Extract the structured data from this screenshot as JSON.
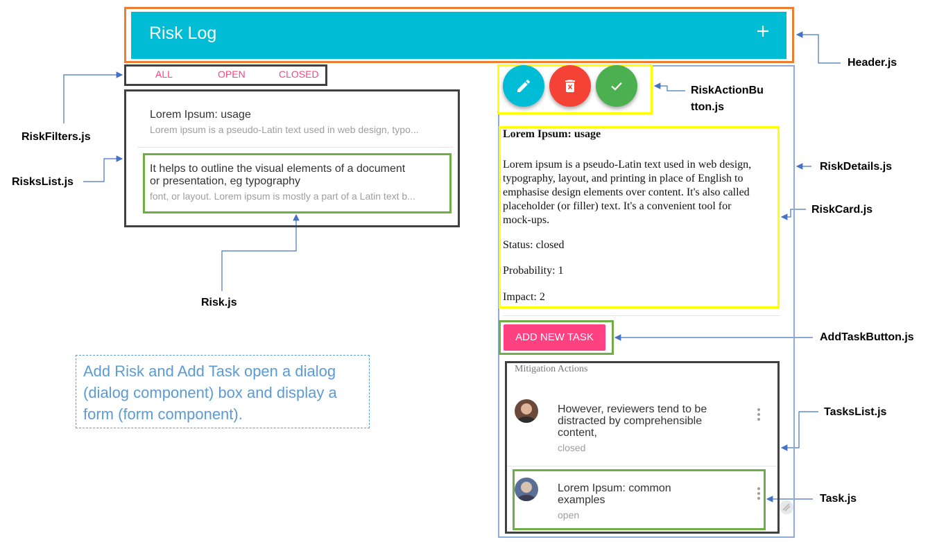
{
  "header": {
    "title": "Risk Log",
    "add_icon": "plus-icon",
    "component_label": "Header.js"
  },
  "filters": {
    "tabs": [
      "ALL",
      "OPEN",
      "CLOSED"
    ],
    "component_label": "RiskFilters.js"
  },
  "risks_list": {
    "component_label": "RisksList.js",
    "items": [
      {
        "title": "Lorem Ipsum: usage",
        "subtitle": "Lorem ipsum is a pseudo-Latin text used in web design, typo..."
      },
      {
        "title_line1": "It helps to outline the visual elements of a document",
        "title_line2": "or presentation, eg typography",
        "subtitle": "font, or layout. Lorem ipsum is mostly a part of a Latin text b..."
      }
    ]
  },
  "risk_label": "Risk.js",
  "risk_action_buttons": {
    "component_label_line1": "RiskActionBu",
    "component_label_line2": "tton.js",
    "buttons": [
      {
        "icon": "pencil-icon",
        "color": "#00BCD4"
      },
      {
        "icon": "trash-icon",
        "color": "#F44336"
      },
      {
        "icon": "check-icon",
        "color": "#4CAF50"
      }
    ]
  },
  "risk_details_label": "RiskDetails.js",
  "risk_card": {
    "component_label": "RiskCard.js",
    "title": "Lorem Ipsum: usage",
    "description_lines": [
      "Lorem ipsum is a pseudo-Latin text used in web design,",
      "typography, layout, and printing in place of English to",
      "emphasise design elements over content. It's also called",
      "placeholder (or filler) text. It's a convenient tool for",
      "mock-ups."
    ],
    "status": "Status: closed",
    "probability": "Probability: 1",
    "impact": "Impact: 2"
  },
  "add_task_button": {
    "label": "ADD NEW TASK",
    "component_label": "AddTaskButton.js"
  },
  "tasks_list": {
    "component_label": "TasksList.js",
    "subheader": "Mitigation Actions",
    "tasks": [
      {
        "title_lines": [
          "However, reviewers tend to be",
          "distracted by comprehensible",
          "content,"
        ],
        "status": "closed",
        "menu_icon": "more-vertical-icon"
      },
      {
        "title_lines": [
          "Lorem Ipsum: common",
          "examples"
        ],
        "status": "open",
        "menu_icon": "more-vertical-icon"
      }
    ]
  },
  "task_label": "Task.js",
  "note": {
    "lines": [
      "Add Risk and Add Task open a dialog",
      "(dialog component) box and display a",
      "form (form component)."
    ]
  },
  "colors": {
    "header_bg": "#00BCD4",
    "accent": "#FF4081",
    "header_frame": "#ED7D31",
    "highlight_frame": "#FFFF00",
    "leaf_frame": "#70AD47",
    "container_frame": "#404040",
    "details_frame": "#8EAADB",
    "arrow": "#4472C4"
  }
}
